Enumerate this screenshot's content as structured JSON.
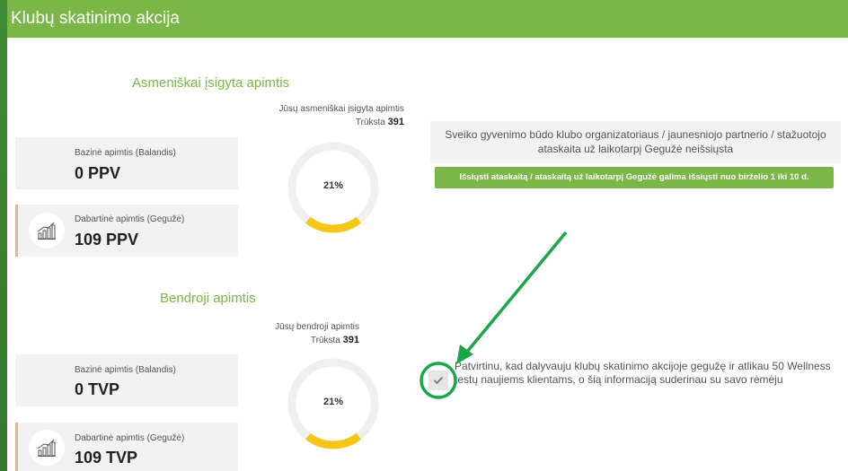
{
  "header": {
    "title": "Klubų skatinimo akcija"
  },
  "personal": {
    "section_title": "Asmeniškai įsigyta apimtis",
    "gauge_caption": "Jūsų asmeniškai įsigyta apimtis",
    "missing_label": "Trūksta",
    "missing_value": "391",
    "gauge_percent_text": "21%",
    "gauge_fill": 0.21,
    "base_label": "Bazinė apimtis (Balandis)",
    "base_value": "0 PPV",
    "current_label": "Dabartinė apimtis (Gegužė)",
    "current_value": "109 PPV"
  },
  "total": {
    "section_title": "Bendroji apimtis",
    "gauge_caption": "Jūsų bendroji apimtis",
    "missing_label": "Trūksta",
    "missing_value": "391",
    "gauge_percent_text": "21%",
    "gauge_fill": 0.21,
    "base_label": "Bazinė apimtis (Balandis)",
    "base_value": "0 TVP",
    "current_label": "Dabartinė apimtis (Gegužė)",
    "current_value": "109 TVP"
  },
  "report": {
    "status_text": "Sveiko gyvenimo būdo klubo organizatoriaus / jaunesniojo partnerio / stažuotojo ataskaita už laikotarpį Gegužė neišsiųsta",
    "send_button": "Išsiųsti ataskaitą / ataskaitą už laikotarpį Gegužė galima išsiųsti nuo birželio 1 iki 10 d."
  },
  "confirm": {
    "text": "Patvirtinu, kad dalyvauju klubų skatinimo akcijoje gegužę ir atlikau 50 Wellness testų naujiems klientams, o šią informaciją suderinau su savo rėmėju"
  },
  "colors": {
    "brand_green": "#7ab648",
    "gauge_fill": "#f5c518",
    "annotation_green": "#1aa64a"
  },
  "icons": {
    "growth": "bar-chart-growth-icon",
    "check": "check-icon"
  }
}
